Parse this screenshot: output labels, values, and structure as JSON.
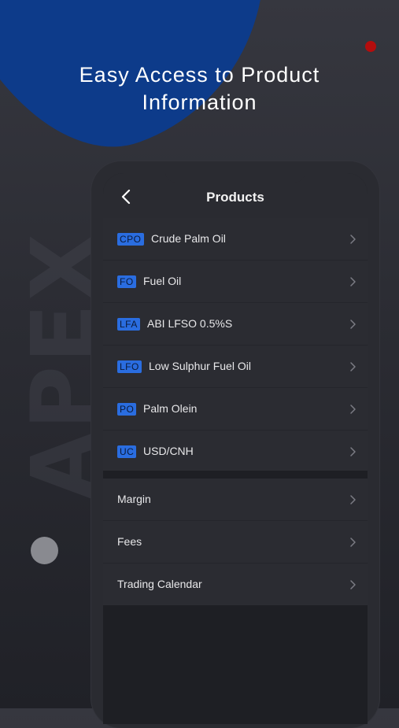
{
  "promo": {
    "headline_line1": "Easy Access to Product",
    "headline_line2": "Information",
    "watermark": "APEX"
  },
  "nav": {
    "title": "Products",
    "back_icon": "chevron-left-icon"
  },
  "products": [
    {
      "code": "CPO",
      "name": "Crude Palm Oil"
    },
    {
      "code": "FO",
      "name": "Fuel Oil"
    },
    {
      "code": "LFA",
      "name": "ABI LFSO 0.5%S"
    },
    {
      "code": "LFO",
      "name": "Low Sulphur Fuel Oil"
    },
    {
      "code": "PO",
      "name": "Palm Olein"
    },
    {
      "code": "UC",
      "name": "USD/CNH"
    }
  ],
  "other_items": [
    {
      "label": "Margin"
    },
    {
      "label": "Fees"
    },
    {
      "label": "Trading Calendar"
    }
  ],
  "colors": {
    "accent_blue": "#2a6de0",
    "blob_blue": "#0d3b8a",
    "red_dot": "#b40d0d"
  }
}
